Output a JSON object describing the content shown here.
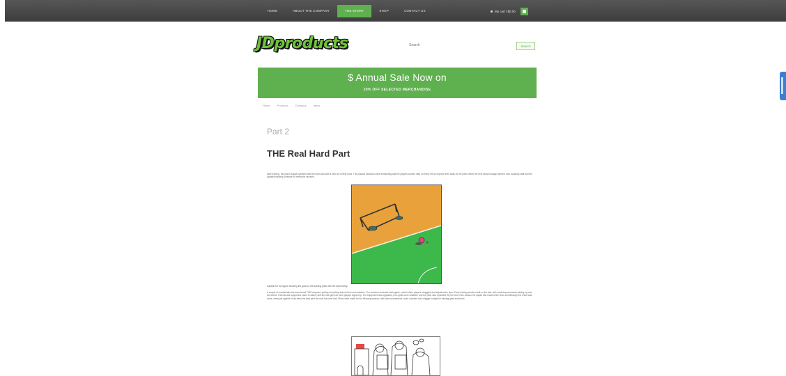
{
  "nav": {
    "items": [
      {
        "label": "Home",
        "active": false
      },
      {
        "label": "About the company",
        "active": false
      },
      {
        "label": "The story",
        "active": true
      },
      {
        "label": "Shop",
        "active": false
      },
      {
        "label": "Contact us",
        "active": false
      }
    ],
    "cart_label": "My cart / $0.00",
    "accent": "#5fb04e"
  },
  "header": {
    "logo_text": "JDproducts",
    "search_placeholder": "Search",
    "search_button": "Search"
  },
  "banner": {
    "title": "$ Annual Sale Now on",
    "subtitle": "20% OFF SELECTED MERCHANDISE",
    "color": "#5fb04e"
  },
  "breadcrumb": [
    "Home",
    "Products",
    "Category",
    "Items"
  ],
  "article": {
    "part": "Part 2",
    "title": "THE Real Hard Part",
    "intro": "After training, the junior league operated with the team and with a new set of field rules. The practice sessions were demanding and the players worked hard on every drill to improve their skills on the pitch before the next season began with the new coaching staff and the updated training schedule for everyone involved.",
    "caption": "Caption for the figure showing the goal on the training pitch with the ball nearby.",
    "body": "A couple of months later the team faced THE hard part: putting everything learned into real matches. The coaches reviewed each game, noted where players struggled and adjusted the plan. Every training session built on the last, with small improvements adding up over the weeks. Parents and supporters came to watch, and the club grew as more players signed up. The equipment was upgraded, new goals were installed, and the pitch was repainted. By the end of the season the squad had reached the final, and although the result was close, everyone agreed it had been the best year the club had ever had. Plans were made for the following season, with new tournaments, more coaches and a bigger budget for training gear and travel."
  }
}
